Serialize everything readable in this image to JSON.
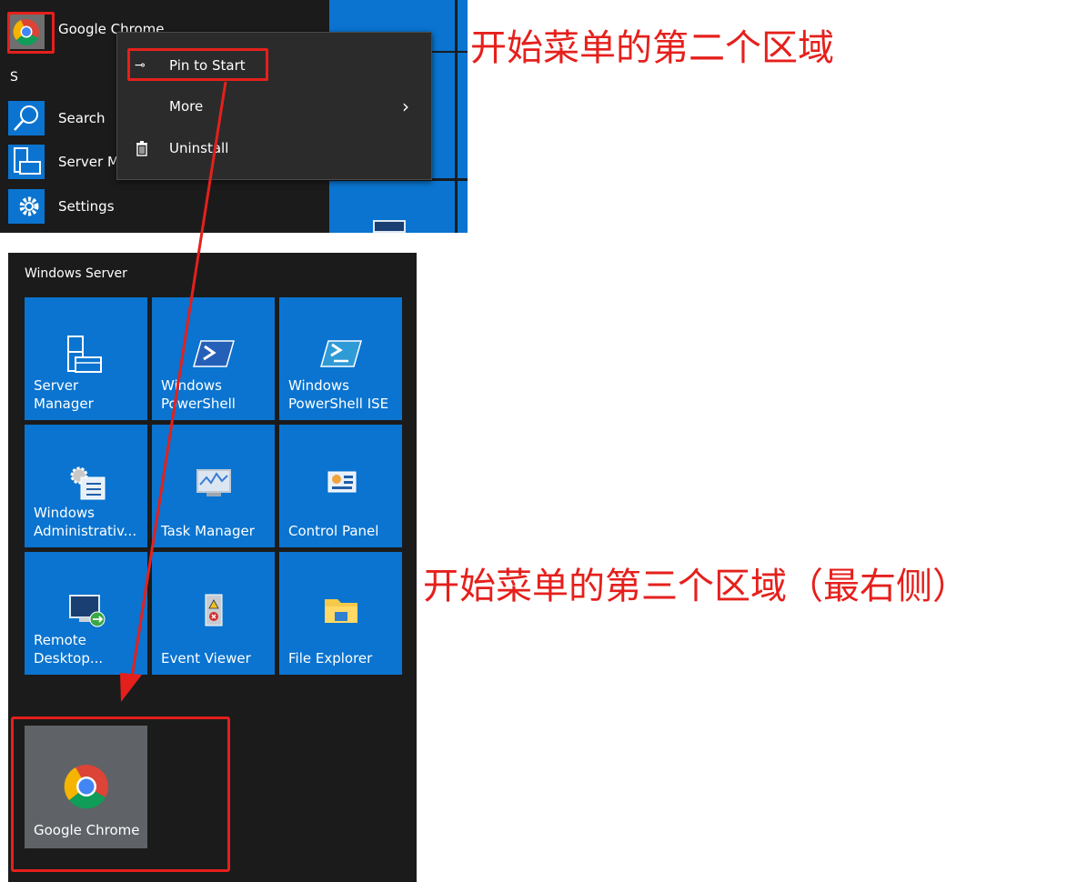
{
  "top_panel": {
    "apps": [
      {
        "label": "Google Chrome",
        "icon": "chrome-icon"
      },
      {
        "label": "Search",
        "icon": "search-icon"
      },
      {
        "label": "Server Manager",
        "icon": "server-manager-icon"
      },
      {
        "label": "Settings",
        "icon": "gear-icon"
      }
    ],
    "section_letter": "S",
    "context_menu": {
      "pin": {
        "label": "Pin to Start",
        "icon": "pin-icon"
      },
      "more": {
        "label": "More",
        "icon": "chevron-right-icon"
      },
      "uninstall": {
        "label": "Uninstall",
        "icon": "trash-icon"
      }
    }
  },
  "bottom_panel": {
    "group_title": "Windows Server",
    "tiles": [
      {
        "label": "Server Manager",
        "icon": "server-manager-icon"
      },
      {
        "label": "Windows PowerShell",
        "icon": "powershell-icon"
      },
      {
        "label": "Windows PowerShell ISE",
        "icon": "powershell-ise-icon"
      },
      {
        "label": "Windows Administrativ...",
        "icon": "admin-tools-icon"
      },
      {
        "label": "Task Manager",
        "icon": "task-manager-icon"
      },
      {
        "label": "Control Panel",
        "icon": "control-panel-icon"
      },
      {
        "label": "Remote Desktop...",
        "icon": "remote-desktop-icon"
      },
      {
        "label": "Event Viewer",
        "icon": "event-viewer-icon"
      },
      {
        "label": "File Explorer",
        "icon": "file-explorer-icon"
      }
    ],
    "pinned_tile": {
      "label": "Google Chrome",
      "icon": "chrome-icon"
    }
  },
  "annotations": {
    "note_top": "开始菜单的第二个区域",
    "note_bottom": "开始菜单的第三个区域（最右侧）"
  },
  "colors": {
    "tile_blue": "#0a74d0",
    "menu_bg": "#1b1b1b",
    "annotation_red": "#e5201c",
    "chrome_tile_gray": "#5f6368"
  }
}
